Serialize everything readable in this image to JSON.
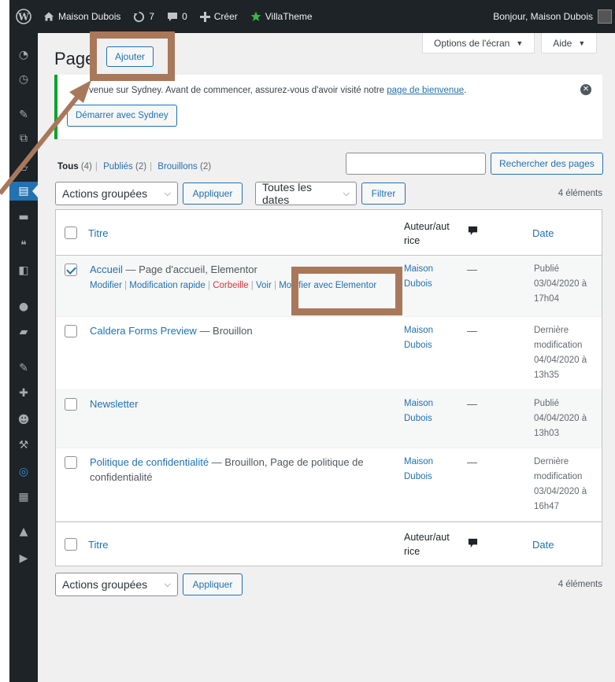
{
  "admin_bar": {
    "site_name": "Maison Dubois",
    "updates_count": "7",
    "comments_count": "0",
    "new_label": "Créer",
    "theme_label": "VillaTheme",
    "greeting": "Bonjour, Maison Dubois"
  },
  "screen_meta": {
    "screen_options": "Options de l'écran",
    "help": "Aide"
  },
  "page": {
    "title": "Page",
    "add_new": "Ajouter"
  },
  "notice": {
    "text_prefix": "venue sur Sydney. Avant de commencer, assurez-vous d'avoir visité notre ",
    "link": "page de bienvenue",
    "text_suffix": ".",
    "button": "Démarrer avec Sydney"
  },
  "filters": {
    "all": "Tous",
    "all_count": "(4)",
    "published": "Publiés",
    "published_count": "(2)",
    "drafts": "Brouillons",
    "drafts_count": "(2)"
  },
  "search": {
    "button": "Rechercher des pages",
    "value": ""
  },
  "tablenav_top": {
    "bulk_actions": "Actions groupées",
    "apply": "Appliquer",
    "dates": "Toutes les dates",
    "filter": "Filtrer",
    "count": "4 éléments"
  },
  "tablenav_bottom": {
    "bulk_actions": "Actions groupées",
    "apply": "Appliquer",
    "count": "4 éléments"
  },
  "table": {
    "headers": {
      "title": "Titre",
      "author": "Auteur/aut rice",
      "date": "Date"
    },
    "rows": [
      {
        "title": "Accueil",
        "state": " — Page d'accueil, Elementor",
        "author": "Maison Dubois",
        "comments": "—",
        "date": "Publié 03/04/2020 à 17h04",
        "checked": true,
        "actions": {
          "edit": "Modifier",
          "quick_edit": "Modification rapide",
          "trash": "Corbeille",
          "view": "Voir",
          "elementor": "Modifier avec Elementor"
        }
      },
      {
        "title": "Caldera Forms Preview",
        "state": " — Brouillon",
        "author": "Maison Dubois",
        "comments": "—",
        "date": "Dernière modification 04/04/2020 à 13h35",
        "checked": false
      },
      {
        "title": "Newsletter",
        "state": "",
        "author": "Maison Dubois",
        "comments": "—",
        "date": "Publié 04/04/2020 à 13h03",
        "checked": false
      },
      {
        "title": "Politique de confidentialité",
        "state": " — Brouillon, Page de politique de confidentialité",
        "author": "Maison Dubois",
        "comments": "—",
        "date": "Dernière modification 03/04/2020 à 16h47",
        "checked": false
      }
    ]
  },
  "colors": {
    "admin_bar": "#1d2327",
    "link": "#2271b1",
    "highlight": "#a9785a",
    "notice_border": "#00a32a"
  }
}
